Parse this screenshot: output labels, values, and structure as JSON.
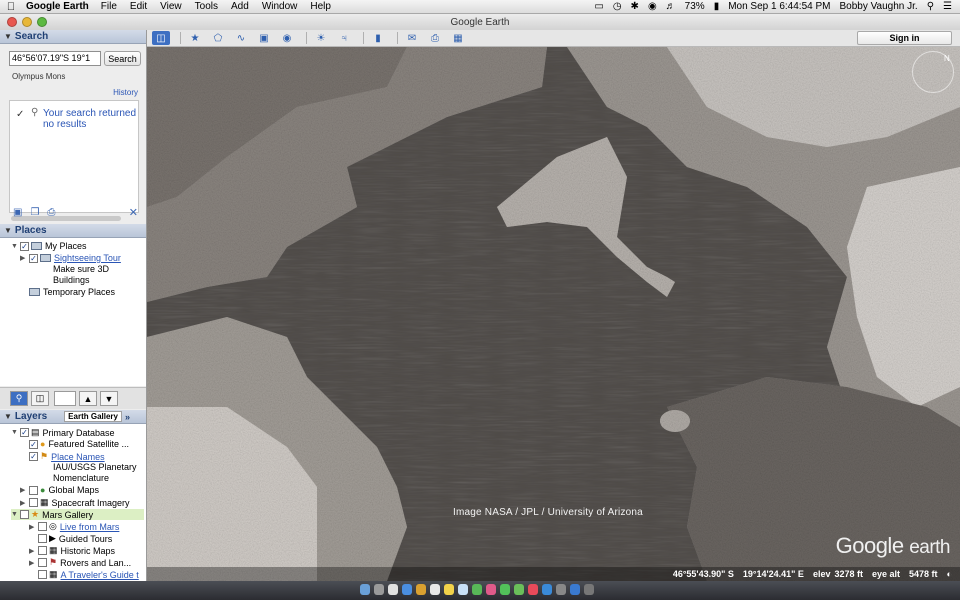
{
  "menubar": {
    "app_name": "Google Earth",
    "menus": [
      "File",
      "Edit",
      "View",
      "Tools",
      "Add",
      "Window",
      "Help"
    ],
    "battery": "73%",
    "datetime": "Mon Sep 1  6:44:54 PM",
    "user": "Bobby Vaughn Jr."
  },
  "window": {
    "title": "Google Earth"
  },
  "toolbar": {
    "sign_in_label": "Sign in"
  },
  "search": {
    "heading": "Search",
    "query_value": "46°56'07.19\"S 19°1",
    "button_label": "Search",
    "previous_query": "Olympus Mons",
    "history_label": "History",
    "result_message": "Your search returned no results"
  },
  "places": {
    "heading": "Places",
    "my_places": "My Places",
    "sightseeing_tour": "Sightseeing Tour",
    "tour_hint": "Make sure 3D Buildings",
    "temporary_places": "Temporary Places"
  },
  "layers": {
    "heading": "Layers",
    "gallery_button": "Earth Gallery",
    "gallery_arrow": "»",
    "items": [
      {
        "label": "Primary Database"
      },
      {
        "label": "Featured Satellite ..."
      },
      {
        "label": "Place Names"
      },
      {
        "label": "IAU/USGS Planetary Nomenclature"
      },
      {
        "label": "Global Maps"
      },
      {
        "label": "Spacecraft Imagery"
      },
      {
        "label": "Mars Gallery"
      },
      {
        "label": "Live from Mars"
      },
      {
        "label": "Guided Tours"
      },
      {
        "label": "Historic Maps"
      },
      {
        "label": "Rovers and Lan..."
      },
      {
        "label": "A Traveler's Guide t"
      }
    ]
  },
  "map": {
    "attribution": "Image NASA / JPL / University of Arizona",
    "logo_google": "Google",
    "logo_earth": "earth",
    "compass_n": "N",
    "status": {
      "lat": "46°55'43.90\" S",
      "lon": "19°14'24.41\" E",
      "elev_label": "elev",
      "elev": "3278 ft",
      "eye_label": "eye alt",
      "eye_alt": "5478 ft"
    }
  },
  "colors": {
    "link_blue": "#2a55b5",
    "panel_header": "#1f3f73",
    "highlight_row": "#dcefc4"
  }
}
